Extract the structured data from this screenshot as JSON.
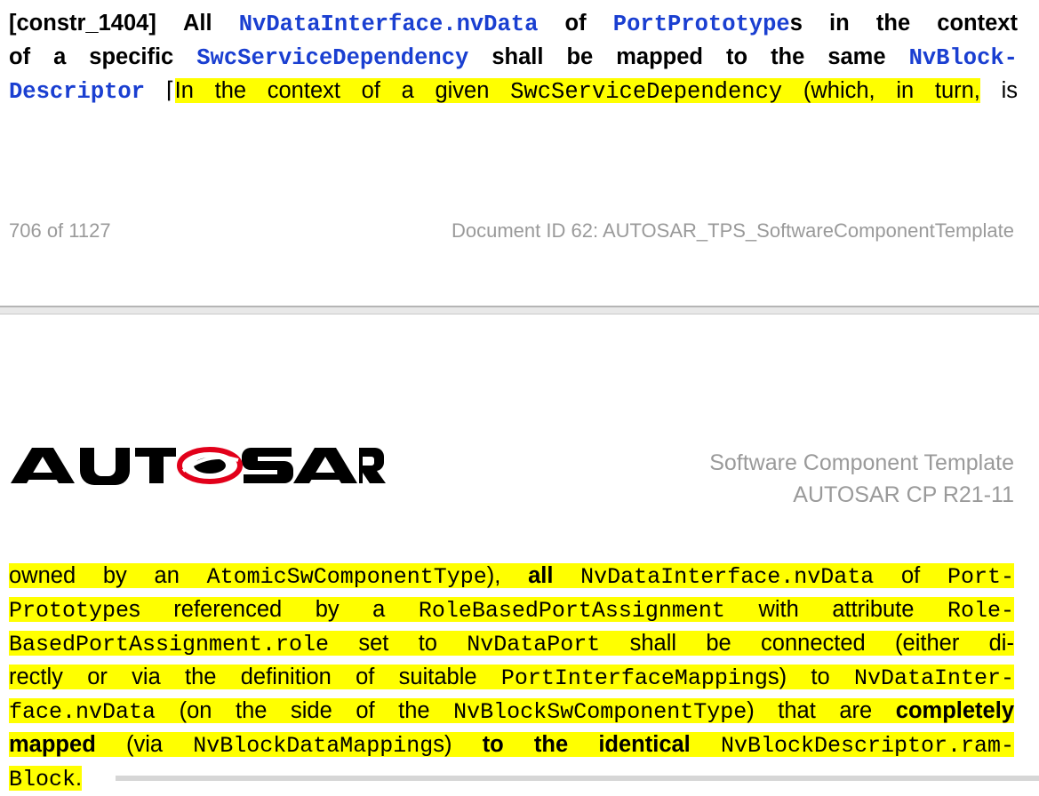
{
  "top": {
    "constraint_id": "[constr_1404]",
    "w_all": "All",
    "ref_nvdata": "NvDataInterface.nvData",
    "w_of": "of",
    "ref_portproto": "PortPrototype",
    "w_s_context": "s in the context",
    "w_of_specific": "of a specific",
    "ref_swcdep": "SwcServiceDependency",
    "w_mapped_same": "shall be mapped to the same",
    "ref_nvblock_a": "NvBlock-",
    "ref_nvblock_b": "Descriptor",
    "bracket": "⌈",
    "h_context": "In the context of a given",
    "h_swcdep": "SwcServiceDependency",
    "h_which": "(which, in turn,",
    "w_is": "is"
  },
  "footer": {
    "page": "706 of 1127",
    "docid": "Document ID 62: AUTOSAR_TPS_SoftwareComponentTemplate"
  },
  "header": {
    "logo": "AUTOSAR",
    "title": "Software Component Template",
    "release": "AUTOSAR CP R21-11"
  },
  "bottom": {
    "l1a": "owned by an",
    "l1b": "AtomicSwComponentType",
    "l1c": "),",
    "l1d": "all",
    "l1e": "NvDataInterface.nvData",
    "l1f": "of",
    "l1g": "Port-",
    "l2a": "Prototype",
    "l2b": "s referenced by a",
    "l2c": "RoleBasedPortAssignment",
    "l2d": "with attribute",
    "l2e": "Role-",
    "l3a": "BasedPortAssignment.role",
    "l3b": "set to",
    "l3c": "NvDataPort",
    "l3d": "shall be connected (either di-",
    "l4a": "rectly or via the definition of suitable",
    "l4b": "PortInterfaceMapping",
    "l4c": "s) to",
    "l4d": "NvDataInter-",
    "l5a": "face.nvData",
    "l5b": "(on the side of the",
    "l5c": "NvBlockSwComponentType",
    "l5d": ") that are",
    "l5e": "completely",
    "l6a": "mapped",
    "l6b": "(via",
    "l6c": "NvBlockDataMapping",
    "l6d": "s)",
    "l6e": "to the identical",
    "l6f": "NvBlockDescriptor.ram-",
    "l7a": "Block",
    "l7b": "."
  }
}
